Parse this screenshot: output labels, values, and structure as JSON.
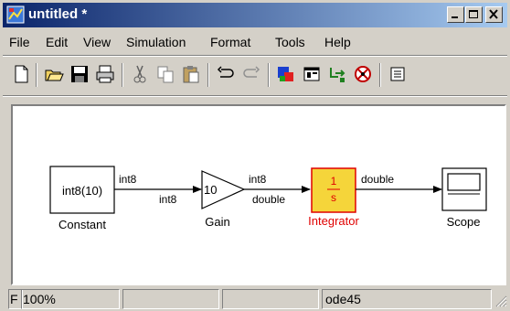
{
  "window": {
    "title": "untitled *"
  },
  "menu": [
    "File",
    "Edit",
    "View",
    "Simulation",
    "Format",
    "Tools",
    "Help"
  ],
  "toolbar_icons": [
    "new-icon",
    "open-icon",
    "save-icon",
    "print-icon",
    "cut-icon",
    "copy-icon",
    "paste-icon",
    "undo-icon",
    "redo-icon",
    "library-browser-icon",
    "model-explorer-icon",
    "debugger-icon",
    "target-icon",
    "more-icon"
  ],
  "blocks": {
    "constant": {
      "value": "int8(10)",
      "label": "Constant"
    },
    "gain": {
      "value": "10",
      "label": "Gain"
    },
    "integrator": {
      "numerator": "1",
      "denominator": "s",
      "label": "Integrator"
    },
    "scope": {
      "label": "Scope"
    }
  },
  "signals": {
    "const_out": "int8",
    "gain_in": "int8",
    "gain_out_top": "int8",
    "gain_out_bottom": "double",
    "integrator_out": "double"
  },
  "status": {
    "left": "F",
    "zoom": "100%",
    "solver": "ode45"
  },
  "colors": {
    "integrator_fill": "#f5d53a",
    "integrator_text": "#e00000",
    "titlebar": "#0a246a"
  }
}
